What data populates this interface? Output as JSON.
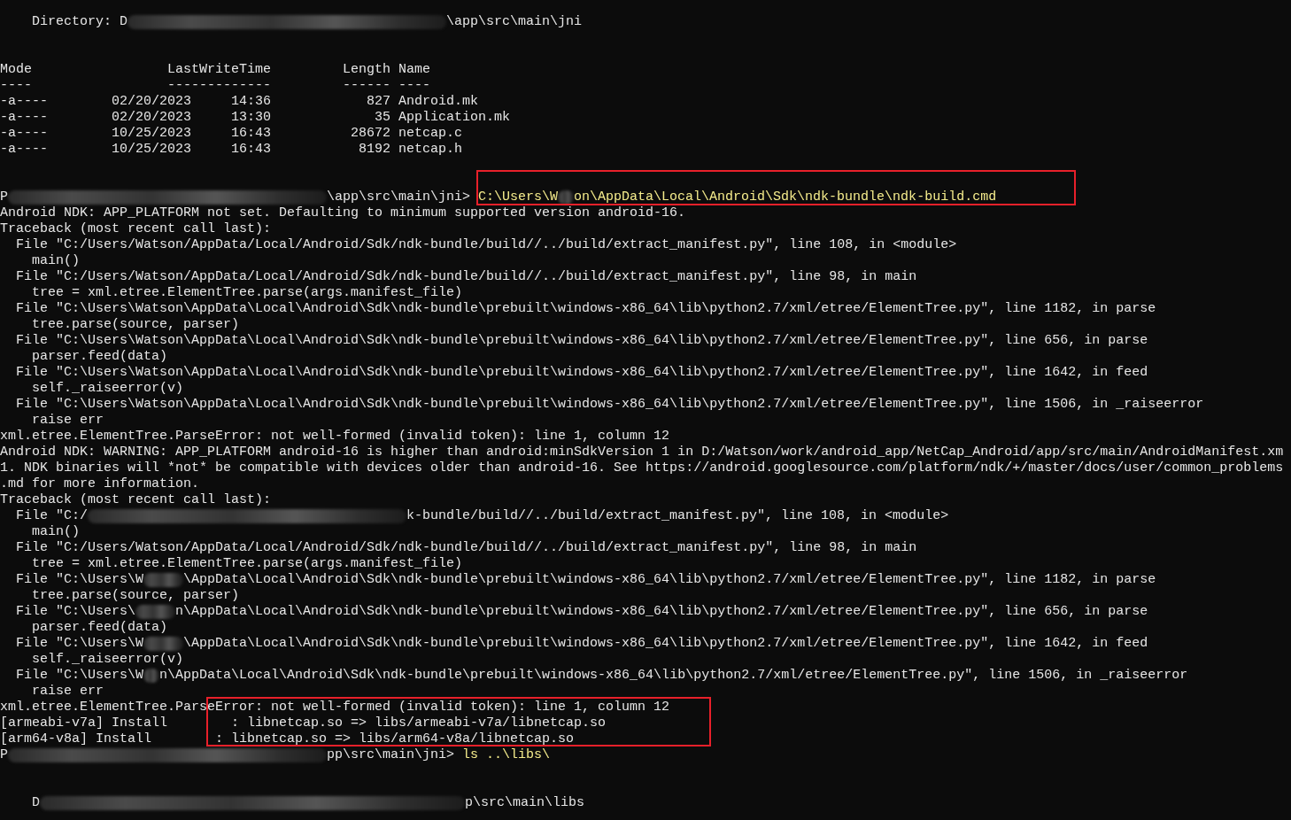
{
  "terminal": {
    "lines": [
      {
        "kind": "text",
        "segments": [
          {
            "kind": "out",
            "text": "    Directory: D"
          },
          {
            "kind": "blur-long"
          },
          {
            "kind": "out",
            "text": "\\app\\src\\main\\jni"
          }
        ]
      },
      {
        "kind": "blank"
      },
      {
        "kind": "blank"
      },
      {
        "kind": "text",
        "segments": [
          {
            "kind": "out",
            "text": "Mode                 LastWriteTime         Length Name"
          }
        ]
      },
      {
        "kind": "text",
        "segments": [
          {
            "kind": "out",
            "text": "----                 -------------         ------ ----"
          }
        ]
      },
      {
        "kind": "text",
        "segments": [
          {
            "kind": "out",
            "text": "-a----        02/20/2023     14:36            827 Android.mk"
          }
        ]
      },
      {
        "kind": "text",
        "segments": [
          {
            "kind": "out",
            "text": "-a----        02/20/2023     13:30             35 Application.mk"
          }
        ]
      },
      {
        "kind": "text",
        "segments": [
          {
            "kind": "out",
            "text": "-a----        10/25/2023     16:43          28672 netcap.c"
          }
        ]
      },
      {
        "kind": "text",
        "segments": [
          {
            "kind": "out",
            "text": "-a----        10/25/2023     16:43           8192 netcap.h"
          }
        ]
      },
      {
        "kind": "blank"
      },
      {
        "kind": "blank"
      },
      {
        "kind": "text",
        "segments": [
          {
            "kind": "prompt",
            "text": "P"
          },
          {
            "kind": "blur-long"
          },
          {
            "kind": "prompt",
            "text": "\\app\\src\\main\\jni> "
          },
          {
            "kind": "cmd",
            "text": "C:\\Users\\W"
          },
          {
            "kind": "blur-tiny"
          },
          {
            "kind": "cmd",
            "text": "on\\AppData\\Local\\Android\\Sdk\\ndk-bundle\\ndk-build.cmd"
          }
        ]
      },
      {
        "kind": "text",
        "segments": [
          {
            "kind": "out",
            "text": "Android NDK: APP_PLATFORM not set. Defaulting to minimum supported version android-16."
          }
        ]
      },
      {
        "kind": "text",
        "segments": [
          {
            "kind": "out",
            "text": "Traceback (most recent call last):"
          }
        ]
      },
      {
        "kind": "text",
        "segments": [
          {
            "kind": "out",
            "text": "  File \"C:/Users/Watson/AppData/Local/Android/Sdk/ndk-bundle/build//../build/extract_manifest.py\", line 108, in <module>"
          }
        ]
      },
      {
        "kind": "text",
        "segments": [
          {
            "kind": "out",
            "text": "    main()"
          }
        ]
      },
      {
        "kind": "text",
        "segments": [
          {
            "kind": "out",
            "text": "  File \"C:/Users/Watson/AppData/Local/Android/Sdk/ndk-bundle/build//../build/extract_manifest.py\", line 98, in main"
          }
        ]
      },
      {
        "kind": "text",
        "segments": [
          {
            "kind": "out",
            "text": "    tree = xml.etree.ElementTree.parse(args.manifest_file)"
          }
        ]
      },
      {
        "kind": "text",
        "segments": [
          {
            "kind": "out",
            "text": "  File \"C:\\Users\\Watson\\AppData\\Local\\Android\\Sdk\\ndk-bundle\\prebuilt\\windows-x86_64\\lib\\python2.7/xml/etree/ElementTree.py\", line 1182, in parse"
          }
        ]
      },
      {
        "kind": "text",
        "segments": [
          {
            "kind": "out",
            "text": "    tree.parse(source, parser)"
          }
        ]
      },
      {
        "kind": "text",
        "segments": [
          {
            "kind": "out",
            "text": "  File \"C:\\Users\\Watson\\AppData\\Local\\Android\\Sdk\\ndk-bundle\\prebuilt\\windows-x86_64\\lib\\python2.7/xml/etree/ElementTree.py\", line 656, in parse"
          }
        ]
      },
      {
        "kind": "text",
        "segments": [
          {
            "kind": "out",
            "text": "    parser.feed(data)"
          }
        ]
      },
      {
        "kind": "text",
        "segments": [
          {
            "kind": "out",
            "text": "  File \"C:\\Users\\Watson\\AppData\\Local\\Android\\Sdk\\ndk-bundle\\prebuilt\\windows-x86_64\\lib\\python2.7/xml/etree/ElementTree.py\", line 1642, in feed"
          }
        ]
      },
      {
        "kind": "text",
        "segments": [
          {
            "kind": "out",
            "text": "    self._raiseerror(v)"
          }
        ]
      },
      {
        "kind": "text",
        "segments": [
          {
            "kind": "out",
            "text": "  File \"C:\\Users\\Watson\\AppData\\Local\\Android\\Sdk\\ndk-bundle\\prebuilt\\windows-x86_64\\lib\\python2.7/xml/etree/ElementTree.py\", line 1506, in _raiseerror"
          }
        ]
      },
      {
        "kind": "text",
        "segments": [
          {
            "kind": "out",
            "text": "    raise err"
          }
        ]
      },
      {
        "kind": "text",
        "segments": [
          {
            "kind": "out",
            "text": "xml.etree.ElementTree.ParseError: not well-formed (invalid token): line 1, column 12"
          }
        ]
      },
      {
        "kind": "text",
        "segments": [
          {
            "kind": "out",
            "text": "Android NDK: WARNING: APP_PLATFORM android-16 is higher than android:minSdkVersion 1 in D:/Watson/work/android_app/NetCap_Android/app/src/main/AndroidManifest.xm"
          }
        ]
      },
      {
        "kind": "text",
        "segments": [
          {
            "kind": "out",
            "text": "1. NDK binaries will *not* be compatible with devices older than android-16. See https://android.googlesource.com/platform/ndk/+/master/docs/user/common_problems"
          }
        ]
      },
      {
        "kind": "text",
        "segments": [
          {
            "kind": "out",
            "text": ".md for more information."
          }
        ]
      },
      {
        "kind": "text",
        "segments": [
          {
            "kind": "out",
            "text": "Traceback (most recent call last):"
          }
        ]
      },
      {
        "kind": "text",
        "segments": [
          {
            "kind": "out",
            "text": "  File \"C:/"
          },
          {
            "kind": "blur-long"
          },
          {
            "kind": "out",
            "text": "k-bundle/build//../build/extract_manifest.py\", line 108, in <module>"
          }
        ]
      },
      {
        "kind": "text",
        "segments": [
          {
            "kind": "out",
            "text": "    main()"
          }
        ]
      },
      {
        "kind": "text",
        "segments": [
          {
            "kind": "out",
            "text": "  File \"C:/Users/Watson/AppData/Local/Android/Sdk/ndk-bundle/build//../build/extract_manifest.py\", line 98, in main"
          }
        ]
      },
      {
        "kind": "text",
        "segments": [
          {
            "kind": "out",
            "text": "    tree = xml.etree.ElementTree.parse(args.manifest_file)"
          }
        ]
      },
      {
        "kind": "text",
        "segments": [
          {
            "kind": "out",
            "text": "  File \"C:\\Users\\W"
          },
          {
            "kind": "blur-short"
          },
          {
            "kind": "out",
            "text": "\\AppData\\Local\\Android\\Sdk\\ndk-bundle\\prebuilt\\windows-x86_64\\lib\\python2.7/xml/etree/ElementTree.py\", line 1182, in parse"
          }
        ]
      },
      {
        "kind": "text",
        "segments": [
          {
            "kind": "out",
            "text": "    tree.parse(source, parser)"
          }
        ]
      },
      {
        "kind": "text",
        "segments": [
          {
            "kind": "out",
            "text": "  File \"C:\\Users\\"
          },
          {
            "kind": "blur-short"
          },
          {
            "kind": "out",
            "text": "n\\AppData\\Local\\Android\\Sdk\\ndk-bundle\\prebuilt\\windows-x86_64\\lib\\python2.7/xml/etree/ElementTree.py\", line 656, in parse"
          }
        ]
      },
      {
        "kind": "text",
        "segments": [
          {
            "kind": "out",
            "text": "    parser.feed(data)"
          }
        ]
      },
      {
        "kind": "text",
        "segments": [
          {
            "kind": "out",
            "text": "  File \"C:\\Users\\W"
          },
          {
            "kind": "blur-short"
          },
          {
            "kind": "out",
            "text": "\\AppData\\Local\\Android\\Sdk\\ndk-bundle\\prebuilt\\windows-x86_64\\lib\\python2.7/xml/etree/ElementTree.py\", line 1642, in feed"
          }
        ]
      },
      {
        "kind": "text",
        "segments": [
          {
            "kind": "out",
            "text": "    self._raiseerror(v)"
          }
        ]
      },
      {
        "kind": "text",
        "segments": [
          {
            "kind": "out",
            "text": "  File \"C:\\Users\\W"
          },
          {
            "kind": "blur-tiny"
          },
          {
            "kind": "out",
            "text": "n\\AppData\\Local\\Android\\Sdk\\ndk-bundle\\prebuilt\\windows-x86_64\\lib\\python2.7/xml/etree/ElementTree.py\", line 1506, in _raiseerror"
          }
        ]
      },
      {
        "kind": "text",
        "segments": [
          {
            "kind": "out",
            "text": "    raise err"
          }
        ]
      },
      {
        "kind": "text",
        "segments": [
          {
            "kind": "out",
            "text": "xml.etree.ElementTree.ParseError: not well-formed (invalid token): line 1, column 12"
          }
        ]
      },
      {
        "kind": "text",
        "segments": [
          {
            "kind": "out",
            "text": "[armeabi-v7a] Install        : libnetcap.so => libs/armeabi-v7a/libnetcap.so"
          }
        ]
      },
      {
        "kind": "text",
        "segments": [
          {
            "kind": "out",
            "text": "[arm64-v8a] Install        : libnetcap.so => libs/arm64-v8a/libnetcap.so"
          }
        ]
      },
      {
        "kind": "text",
        "segments": [
          {
            "kind": "prompt",
            "text": "P"
          },
          {
            "kind": "blur-long"
          },
          {
            "kind": "prompt",
            "text": "pp\\src\\main\\jni> "
          },
          {
            "kind": "cmd",
            "text": "ls ..\\libs\\"
          }
        ]
      },
      {
        "kind": "blank"
      },
      {
        "kind": "blank"
      },
      {
        "kind": "text",
        "segments": [
          {
            "kind": "out",
            "text": "    D"
          },
          {
            "kind": "blur-xlong"
          },
          {
            "kind": "out",
            "text": "p\\src\\main\\libs"
          }
        ]
      }
    ]
  },
  "annotations": [
    {
      "kind": "red-frame"
    },
    {
      "kind": "red-frame"
    }
  ]
}
